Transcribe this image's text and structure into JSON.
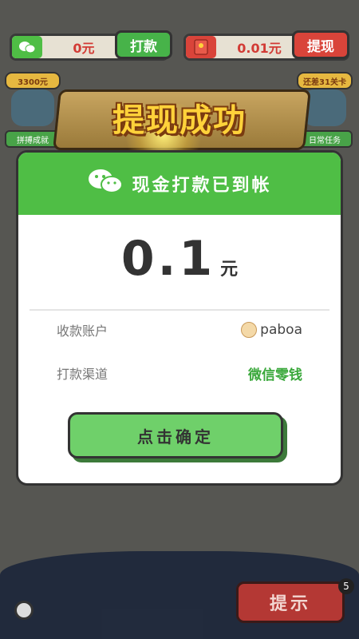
{
  "topbar": {
    "left_amount": "0元",
    "pay_button": "打款",
    "right_amount": "0.01元",
    "withdraw_button": "提现"
  },
  "side_left": {
    "tag": "3300元",
    "caption": "拼搏成就"
  },
  "side_right": {
    "tag": "还差31关卡",
    "caption": "日常任务"
  },
  "banner": {
    "title": "提现成功"
  },
  "modal": {
    "header": "现金打款已到帐",
    "amount": "0.1",
    "unit": "元",
    "rows": [
      {
        "label": "收款账户",
        "value": "paboa"
      },
      {
        "label": "打款渠道",
        "value": "微信零钱"
      }
    ],
    "confirm_button": "点击确定"
  },
  "bottom": {
    "hint_button": "提示",
    "hint_count": "5"
  },
  "colors": {
    "green": "#4fbe45",
    "red": "#d9443a",
    "gold": "#ffd23a"
  },
  "icons": [
    "wechat-icon",
    "red-envelope-icon",
    "settings-icon"
  ]
}
